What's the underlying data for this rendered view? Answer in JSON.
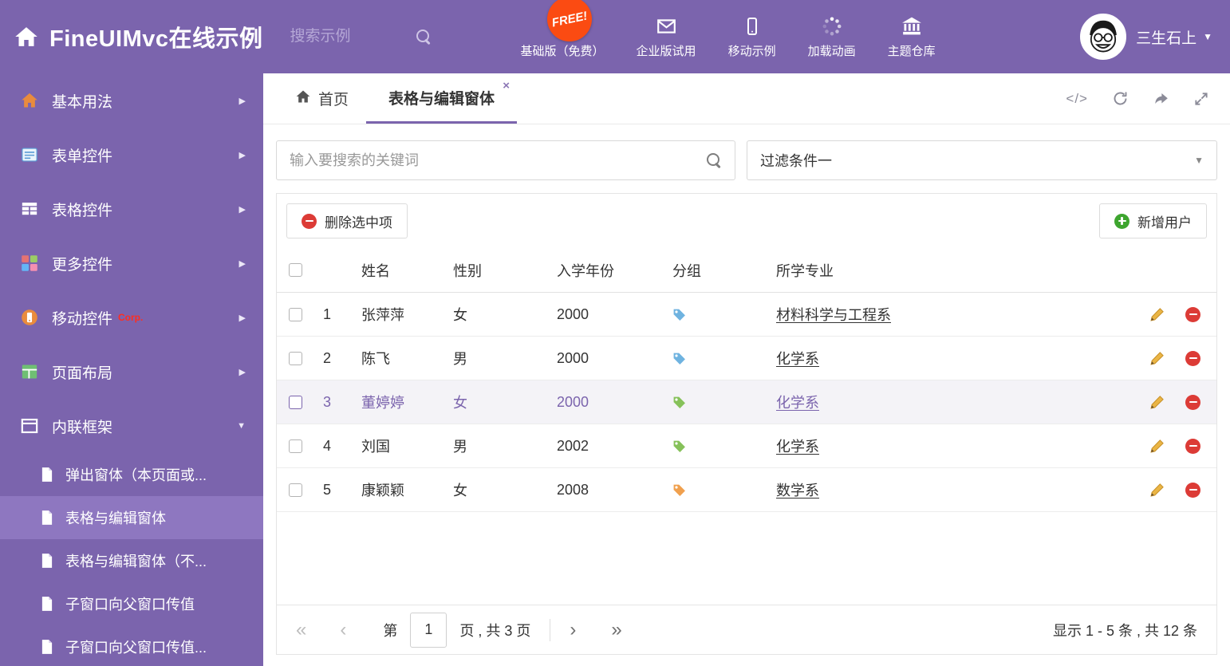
{
  "colors": {
    "brand_purple": "#7b64ad",
    "sidebar_selected": "#8e77c0",
    "free_badge_red": "#fb4b12",
    "delete_red": "#dc3b36",
    "add_green": "#3ea52f",
    "tag_blue": "#6fb3e0",
    "tag_green": "#86c15a",
    "tag_orange": "#f0a04e",
    "corp_red": "#ff2d21"
  },
  "glyphs": {
    "caret_down": "▼",
    "chevron_right": "▶",
    "close": "×",
    "first": "«",
    "prev": "‹",
    "next": "›",
    "last": "»",
    "code": "</>"
  },
  "header": {
    "title": "FineUIMvc在线示例",
    "search_placeholder": "搜索示例",
    "free_badge": "FREE!",
    "actions": [
      {
        "label": "基础版（免费）",
        "icon": "download-icon"
      },
      {
        "label": "企业版试用",
        "icon": "envelope-icon"
      },
      {
        "label": "移动示例",
        "icon": "mobile-icon"
      },
      {
        "label": "加载动画",
        "icon": "spinner-icon"
      },
      {
        "label": "主题仓库",
        "icon": "bank-icon"
      }
    ],
    "user_name": "三生石上"
  },
  "sidebar": {
    "items": [
      {
        "label": "基本用法"
      },
      {
        "label": "表单控件"
      },
      {
        "label": "表格控件"
      },
      {
        "label": "更多控件"
      },
      {
        "label": "移动控件",
        "badge": "Corp."
      },
      {
        "label": "页面布局"
      },
      {
        "label": "内联框架",
        "expanded": true
      }
    ],
    "subitems": [
      {
        "label": "弹出窗体（本页面或..."
      },
      {
        "label": "表格与编辑窗体",
        "selected": true
      },
      {
        "label": "表格与编辑窗体（不..."
      },
      {
        "label": "子窗口向父窗口传值"
      },
      {
        "label": "子窗口向父窗口传值..."
      }
    ]
  },
  "tabs": {
    "home": "首页",
    "active": "表格与编辑窗体"
  },
  "filters": {
    "search_placeholder": "输入要搜索的关键词",
    "filter_value": "过滤条件一"
  },
  "toolbar": {
    "delete_label": "删除选中项",
    "add_label": "新增用户"
  },
  "table": {
    "columns": [
      "姓名",
      "性别",
      "入学年份",
      "分组",
      "所学专业"
    ],
    "rows": [
      {
        "num": "1",
        "name": "张萍萍",
        "gender": "女",
        "year": "2000",
        "tag_color": "blue",
        "major": "材料科学与工程系",
        "selected": false
      },
      {
        "num": "2",
        "name": "陈飞",
        "gender": "男",
        "year": "2000",
        "tag_color": "blue",
        "major": "化学系",
        "selected": false
      },
      {
        "num": "3",
        "name": "董婷婷",
        "gender": "女",
        "year": "2000",
        "tag_color": "green",
        "major": "化学系",
        "selected": true
      },
      {
        "num": "4",
        "name": "刘国",
        "gender": "男",
        "year": "2002",
        "tag_color": "green",
        "major": "化学系",
        "selected": false
      },
      {
        "num": "5",
        "name": "康颖颖",
        "gender": "女",
        "year": "2008",
        "tag_color": "orange",
        "major": "数学系",
        "selected": false
      }
    ]
  },
  "pagination": {
    "page_label_prefix": "第",
    "current_page": "1",
    "page_label_suffix": "页 , 共 3 页",
    "summary": "显示 1 - 5 条 , 共 12 条"
  }
}
